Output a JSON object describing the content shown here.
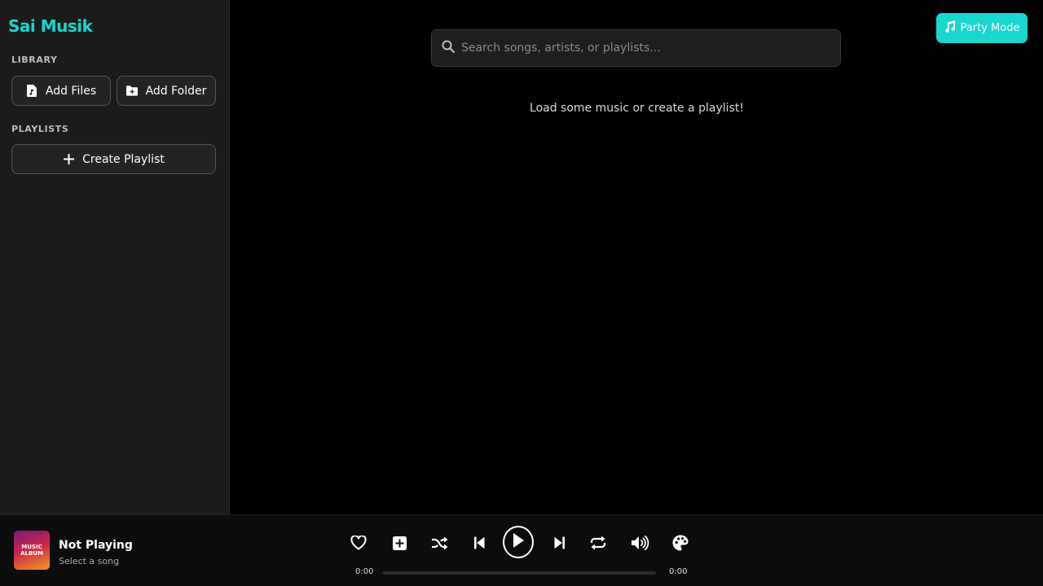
{
  "app": {
    "name": "Sai Musik",
    "accent": "#19d6cf"
  },
  "sidebar": {
    "library_label": "LIBRARY",
    "add_files_label": "Add Files",
    "add_folder_label": "Add Folder",
    "playlists_label": "PLAYLISTS",
    "create_playlist_label": "Create Playlist"
  },
  "main": {
    "search_placeholder": "Search songs, artists, or playlists...",
    "empty_message": "Load some music or create a playlist!",
    "party_mode_label": "Party Mode"
  },
  "player": {
    "album_text_line1": "MUSIC",
    "album_text_line2": "ALBUM",
    "track_title": "Not Playing",
    "track_subtitle": "Select a song",
    "current_time": "0:00",
    "total_time": "0:00",
    "progress": 0,
    "controls": [
      "heart-icon",
      "add-to-playlist-icon",
      "shuffle-icon",
      "previous-icon",
      "play-icon",
      "next-icon",
      "repeat-icon",
      "volume-icon",
      "palette-icon"
    ]
  }
}
